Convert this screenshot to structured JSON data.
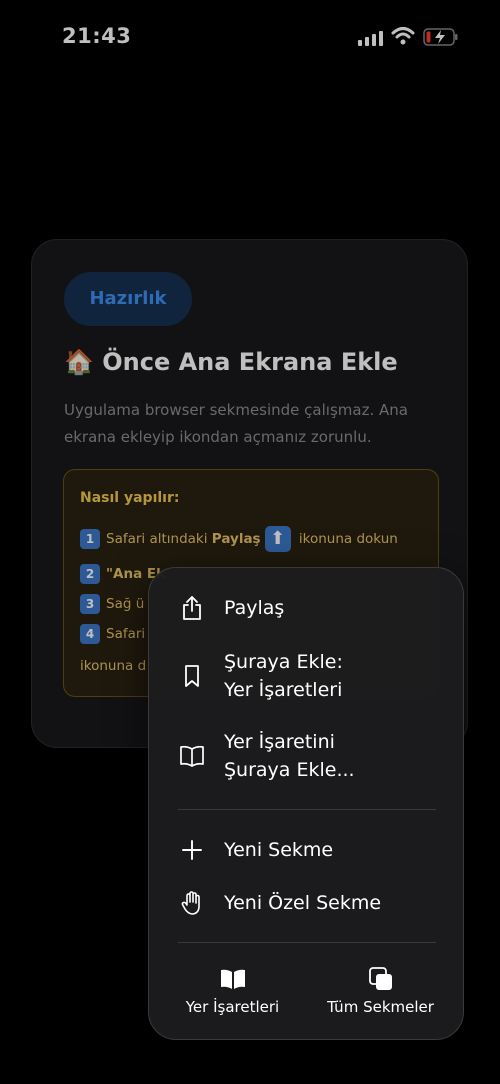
{
  "status_bar": {
    "time": "21:43"
  },
  "card": {
    "badge": "Hazırlık",
    "title": "🏠 Önce Ana Ekrana Ekle",
    "description": "Uygulama browser sekmesinde çalışmaz. Ana ekrana ekleyip ikondan açmanız zorunlu.",
    "steps_title": "Nasıl yapılır:",
    "step1_pre": "Safari altındaki ",
    "step1_bold": "Paylaş",
    "step1_post": " ikonuna dokun",
    "step2": "\"Ana Ek",
    "step3": "Sağ ü",
    "step4": "Safari",
    "step5": "ikonuna d",
    "keycaps": [
      "1",
      "2",
      "3",
      "4"
    ]
  },
  "menu": {
    "share": "Paylaş",
    "add_bookmark_line1": "Şuraya Ekle:",
    "add_bookmark_line2": "Yer İşaretleri",
    "add_reading_line1": "Yer İşaretini",
    "add_reading_line2": "Şuraya Ekle...",
    "new_tab": "Yeni Sekme",
    "new_private_tab": "Yeni Özel Sekme",
    "bookmarks": "Yer İşaretleri",
    "all_tabs": "Tüm Sekmeler"
  },
  "colors": {
    "badge_text": "#3f8ef0",
    "steps_text": "#e8c46a",
    "background": "#000000"
  }
}
